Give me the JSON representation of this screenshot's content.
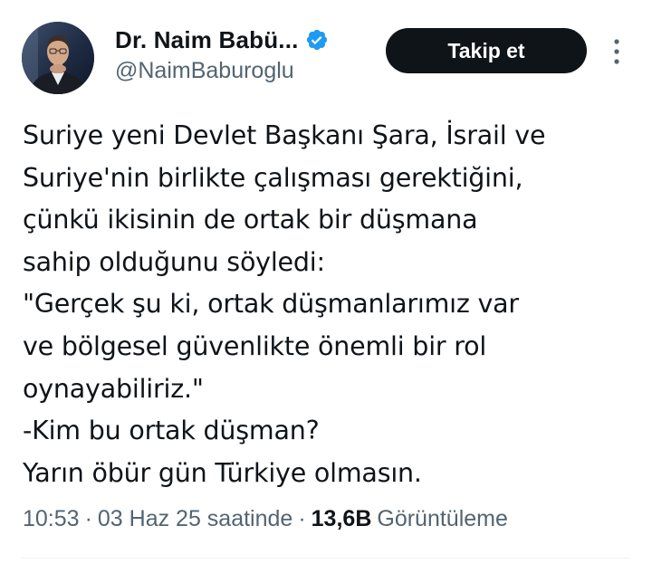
{
  "author": {
    "display_name": "Dr. Naim Babü...",
    "handle": "@NaimBaburoglu",
    "verified": true,
    "verified_badge_icon": "verified-badge-icon"
  },
  "follow_button": {
    "label": "Takip et"
  },
  "more_menu": {
    "icon": "more-vertical-icon"
  },
  "tweet": {
    "lines": [
      "Suriye yeni Devlet Başkanı Şara, İsrail ve",
      "Suriye'nin birlikte çalışması gerektiğini,",
      "çünkü ikisinin de ortak bir düşmana",
      "sahip olduğunu söyledi:",
      "\"Gerçek şu ki, ortak düşmanlarımız var",
      "ve bölgesel güvenlikte önemli bir rol",
      "oynayabiliriz.\"",
      "-Kim bu ortak düşman?",
      "Yarın öbür gün Türkiye olmasın."
    ]
  },
  "meta": {
    "time": "10:53",
    "separator": "·",
    "date": "03 Haz 25 saatinde",
    "views_count": "13,6B",
    "views_label": "Görüntüleme"
  },
  "colors": {
    "text_primary": "#0f1419",
    "text_secondary": "#536471",
    "verified_blue": "#1d9bf0",
    "button_bg": "#0f1419",
    "button_text": "#ffffff",
    "divider": "#eff3f4"
  }
}
